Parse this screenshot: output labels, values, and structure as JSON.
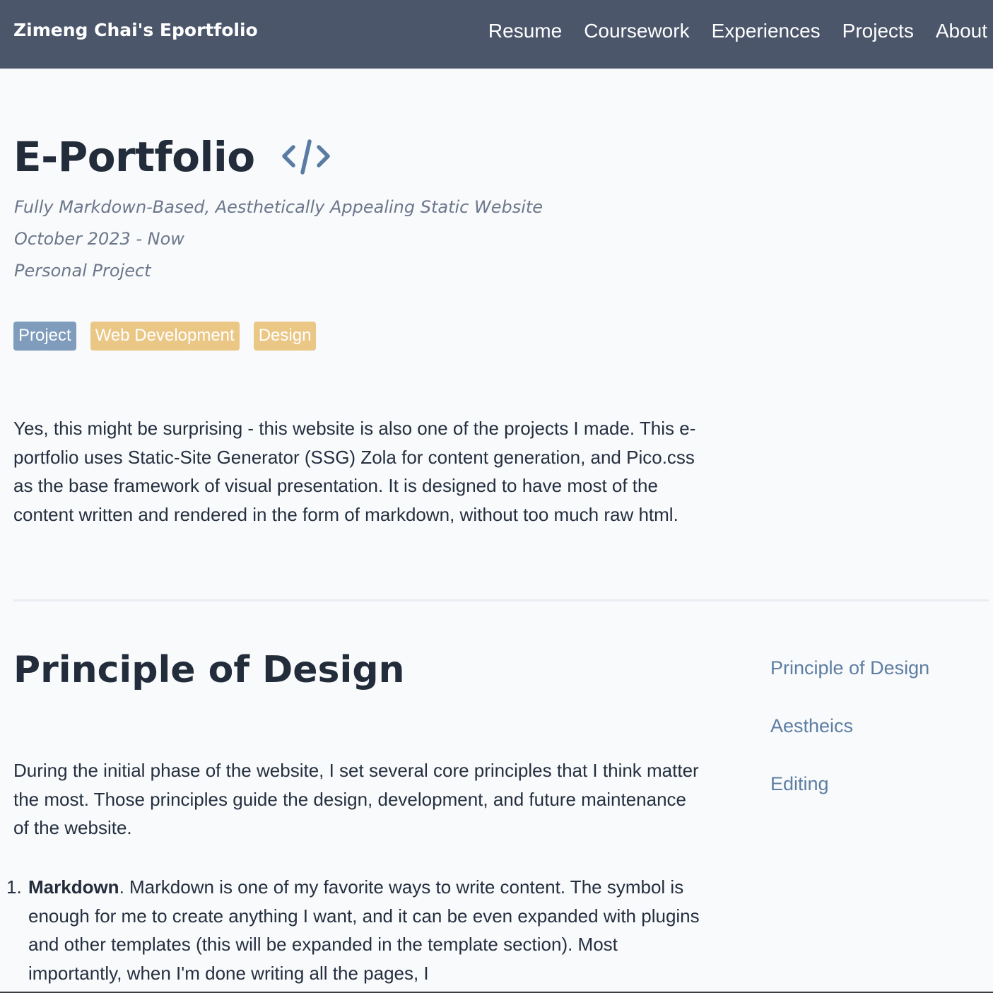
{
  "navbar": {
    "brand": "Zimeng Chai's Eportfolio",
    "links": [
      "Resume",
      "Coursework",
      "Experiences",
      "Projects",
      "About"
    ]
  },
  "hero": {
    "title": "E-Portfolio",
    "icon": "code-brackets-icon",
    "subtitle": "Fully Markdown-Based, Aesthetically Appealing Static Website",
    "date": "October 2023 - Now",
    "type": "Personal Project"
  },
  "tags": [
    {
      "label": "Project",
      "color": "#7f9cbd"
    },
    {
      "label": "Web Development",
      "color": "#ebc786"
    },
    {
      "label": "Design",
      "color": "#ebc786"
    }
  ],
  "intro": "Yes, this might be surprising - this website is also one of the projects I made. This e-portfolio uses Static-Site Generator (SSG) Zola for content generation, and Pico.css as the base framework of visual presentation. It is designed to have most of the content written and rendered in the form of markdown, without too much raw html.",
  "section": {
    "title": "Principle of Design",
    "body": "During the initial phase of the website, I set several core principles that I think matter the most. Those principles guide the design, development, and future maintenance of the website."
  },
  "toc": [
    "Principle of Design",
    "Aestheics",
    "Editing"
  ],
  "list": [
    {
      "number": "1.",
      "bold": "Markdown",
      "text": ". Markdown is one of my favorite ways to write content. The symbol is enough for me to create anything I want, and it can be even expanded with plugins and other templates (this will be expanded in the template section). Most importantly, when I'm done writing all the pages, I"
    }
  ],
  "colors": {
    "navbar_bg": "#4b566b",
    "page_bg": "#f9fafc",
    "accent_link": "#5d7ea3",
    "code_icon": "#5a7ca3"
  }
}
